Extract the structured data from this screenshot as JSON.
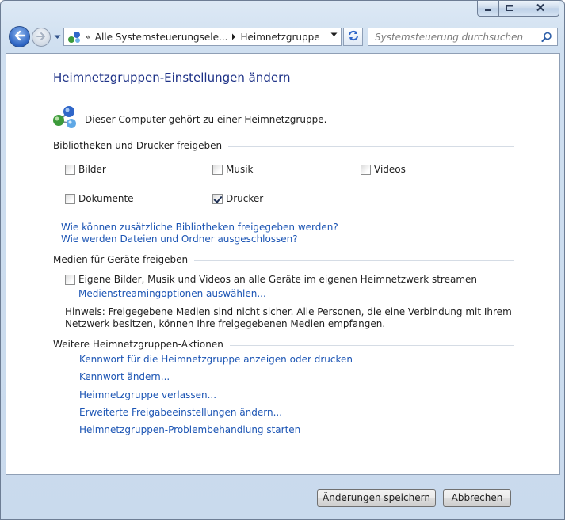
{
  "window": {
    "caption_buttons": {
      "minimize_icon": "minimize-icon",
      "maximize_icon": "maximize-icon",
      "close_icon": "close-icon"
    }
  },
  "navigation": {
    "back_icon": "back-arrow-icon",
    "forward_icon": "forward-arrow-icon",
    "address": {
      "chevrons": "«",
      "crumbs": [
        "Alle Systemsteuerungsele...",
        "Heimnetzgruppe"
      ]
    },
    "search": {
      "placeholder": "Systemsteuerung durchsuchen"
    }
  },
  "colors": {
    "title": "#1e3287",
    "link": "#1c55b4",
    "background": "#cfdff0"
  },
  "page": {
    "title": "Heimnetzgruppen-Einstellungen ändern",
    "membership_text": "Dieser Computer gehört zu einer Heimnetzgruppe.",
    "icon": "homegroup-icon"
  },
  "share_section": {
    "header": "Bibliotheken und Drucker freigeben",
    "items": [
      {
        "label": "Bilder",
        "checked": false
      },
      {
        "label": "Musik",
        "checked": false
      },
      {
        "label": "Videos",
        "checked": false
      },
      {
        "label": "Dokumente",
        "checked": false
      },
      {
        "label": "Drucker",
        "checked": true
      }
    ],
    "links": [
      "Wie können zusätzliche Bibliotheken freigegeben werden?",
      "Wie werden Dateien und Ordner ausgeschlossen?"
    ]
  },
  "media_section": {
    "header": "Medien für Geräte freigeben",
    "stream_label": "Eigene Bilder, Musik und Videos an alle Geräte im eigenen Heimnetzwerk streamen",
    "stream_checked": false,
    "options_link": "Medienstreamingoptionen auswählen...",
    "hint": "Hinweis: Freigegebene Medien sind nicht sicher. Alle Personen, die eine Verbindung mit Ihrem Netzwerk besitzen, können Ihre freigegebenen Medien empfangen."
  },
  "actions_section": {
    "header": "Weitere Heimnetzgruppen-Aktionen",
    "links": [
      "Kennwort für die Heimnetzgruppe anzeigen oder drucken",
      "Kennwort ändern...",
      "Heimnetzgruppe verlassen...",
      "Erweiterte Freigabeeinstellungen ändern...",
      "Heimnetzgruppen-Problembehandlung starten"
    ]
  },
  "footer": {
    "save_label": "Änderungen speichern",
    "cancel_label": "Abbrechen"
  }
}
